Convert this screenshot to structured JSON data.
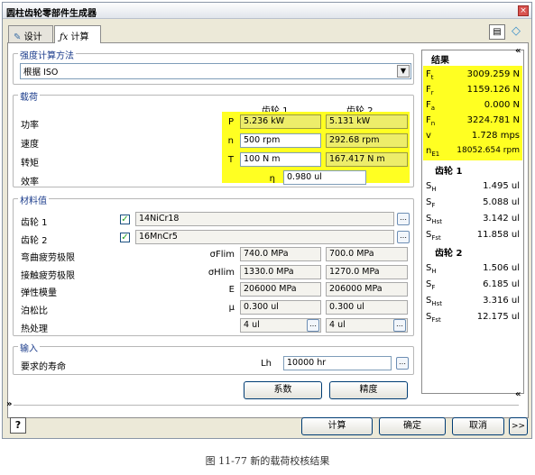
{
  "window": {
    "title": "圆柱齿轮零部件生成器",
    "close": "×"
  },
  "tabs": [
    {
      "label": "设计"
    },
    {
      "label": "计算"
    }
  ],
  "strength": {
    "title": "强度计算方法",
    "method": "根据 ISO"
  },
  "loads": {
    "title": "载荷",
    "col1": "齿轮 1",
    "col2": "齿轮 2",
    "rows": [
      {
        "label": "功率",
        "sym": "P",
        "v1": "5.236 kW",
        "v2": "5.131 kW"
      },
      {
        "label": "速度",
        "sym": "n",
        "v1": "500 rpm",
        "v2": "292.68 rpm"
      },
      {
        "label": "转矩",
        "sym": "T",
        "v1": "100 N m",
        "v2": "167.417 N m"
      }
    ],
    "eff_label": "效率",
    "eff_sym": "η",
    "eff_val": "0.980 ul"
  },
  "material": {
    "title": "材料值",
    "gear1_label": "齿轮 1",
    "gear1_val": "14NiCr18",
    "gear2_label": "齿轮 2",
    "gear2_val": "16MnCr5",
    "rows": [
      {
        "label": "弯曲疲劳极限",
        "sym": "σFlim",
        "v1": "740.0 MPa",
        "v2": "700.0 MPa"
      },
      {
        "label": "接触疲劳极限",
        "sym": "σHlim",
        "v1": "1330.0 MPa",
        "v2": "1270.0 MPa"
      },
      {
        "label": "弹性模量",
        "sym": "E",
        "v1": "206000 MPa",
        "v2": "206000 MPa"
      },
      {
        "label": "泊松比",
        "sym": "μ",
        "v1": "0.300 ul",
        "v2": "0.300 ul"
      },
      {
        "label": "热处理",
        "sym": "",
        "v1": "4 ul",
        "v2": "4 ul"
      }
    ]
  },
  "input": {
    "title": "输入",
    "life_label": "要求的寿命",
    "life_sym": "Lh",
    "life_val": "10000 hr"
  },
  "buttons": {
    "factors": "系数",
    "accuracy": "精度",
    "calculate": "计算",
    "ok": "确定",
    "cancel": "取消",
    "more": ">>"
  },
  "results": {
    "title": "结果",
    "forces": [
      {
        "sym": "Ft",
        "val": "3009.259 N"
      },
      {
        "sym": "Fr",
        "val": "1159.126 N"
      },
      {
        "sym": "Fa",
        "val": "0.000 N"
      },
      {
        "sym": "Fn",
        "val": "3224.781 N"
      },
      {
        "sym": "v",
        "val": "1.728 mps"
      },
      {
        "sym": "nE1",
        "val": "18052.654 rpm"
      }
    ],
    "gear1_title": "齿轮 1",
    "gear1": [
      {
        "sym": "SH",
        "val": "1.495 ul"
      },
      {
        "sym": "SF",
        "val": "5.088 ul"
      },
      {
        "sym": "SHst",
        "val": "3.142 ul"
      },
      {
        "sym": "SFst",
        "val": "11.858 ul"
      }
    ],
    "gear2_title": "齿轮 2",
    "gear2": [
      {
        "sym": "SH",
        "val": "1.506 ul"
      },
      {
        "sym": "SF",
        "val": "6.185 ul"
      },
      {
        "sym": "SHst",
        "val": "3.316 ul"
      },
      {
        "sym": "SFst",
        "val": "12.175 ul"
      }
    ]
  },
  "caption": "图 11-77 新的载荷校核结果",
  "colors": {
    "highlight": "#ffff22",
    "accent": "#1c3d8c"
  }
}
